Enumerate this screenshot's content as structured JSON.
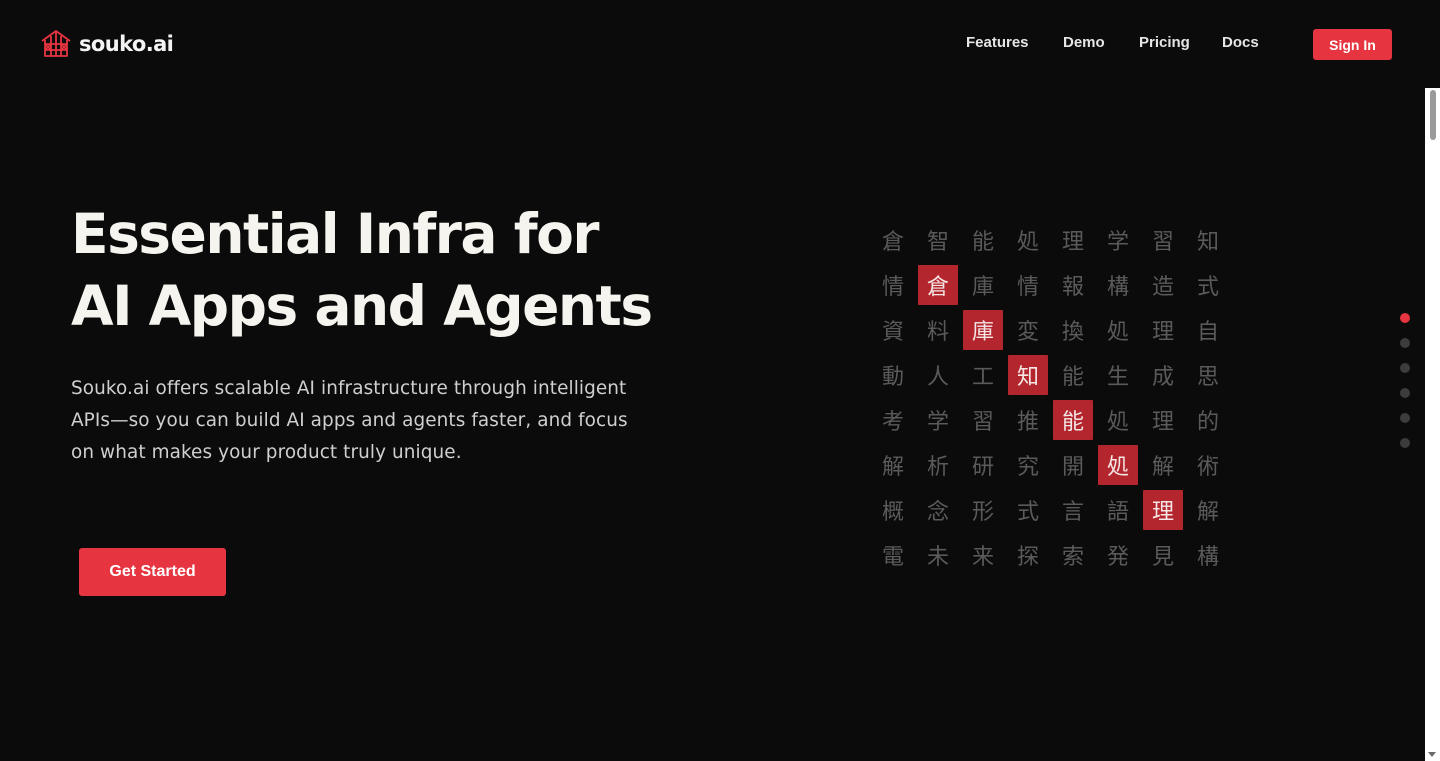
{
  "brand": {
    "name": "souko.ai",
    "logo_icon": "warehouse-icon",
    "accent": "#e63540"
  },
  "nav": {
    "links": [
      "Features",
      "Demo",
      "Pricing",
      "Docs"
    ],
    "signin_label": "Sign In"
  },
  "hero": {
    "title_line1": "Essential Infra for",
    "title_line2": "AI Apps and Agents",
    "description": "Souko.ai offers scalable AI infrastructure through intelligent APIs—so you can build AI apps and agents faster, and focus on what makes your product truly unique.",
    "cta_label": "Get Started"
  },
  "kanji_grid": {
    "rows": [
      [
        "倉",
        "智",
        "能",
        "処",
        "理",
        "学",
        "習",
        "知"
      ],
      [
        "情",
        "倉",
        "庫",
        "情",
        "報",
        "構",
        "造",
        "式"
      ],
      [
        "資",
        "料",
        "庫",
        "変",
        "換",
        "処",
        "理",
        "自"
      ],
      [
        "動",
        "人",
        "工",
        "知",
        "能",
        "生",
        "成",
        "思"
      ],
      [
        "考",
        "学",
        "習",
        "推",
        "能",
        "処",
        "理",
        "的"
      ],
      [
        "解",
        "析",
        "研",
        "究",
        "開",
        "処",
        "解",
        "術"
      ],
      [
        "概",
        "念",
        "形",
        "式",
        "言",
        "語",
        "理",
        "解"
      ],
      [
        "電",
        "未",
        "来",
        "探",
        "索",
        "発",
        "見",
        "構"
      ]
    ],
    "highlight": [
      [
        1,
        1
      ],
      [
        2,
        2
      ],
      [
        3,
        3
      ],
      [
        4,
        4
      ],
      [
        5,
        5
      ],
      [
        6,
        6
      ]
    ],
    "highlight_color": "#b3262e"
  },
  "section_dots": {
    "count": 6,
    "active_index": 0
  }
}
